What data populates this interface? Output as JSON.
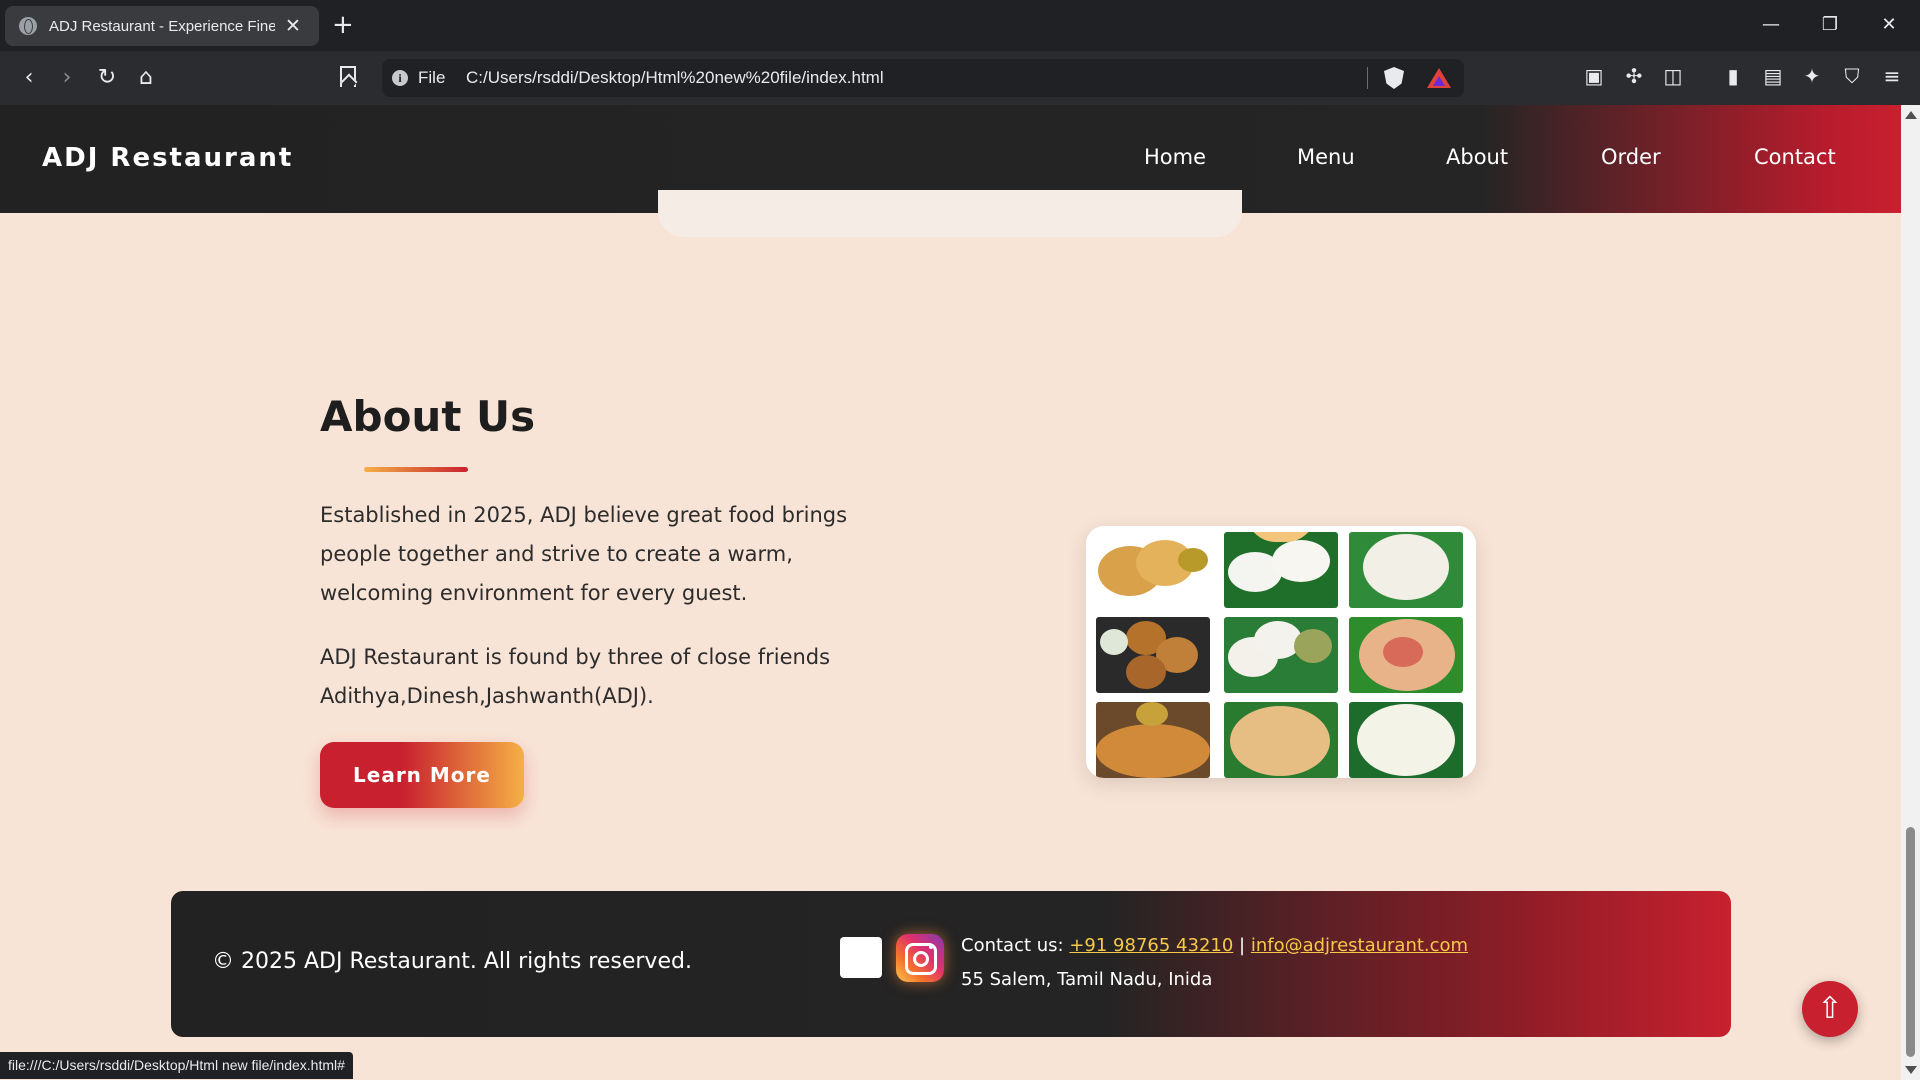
{
  "browser": {
    "tab_title": "ADJ Restaurant - Experience Fine",
    "url_scheme": "File",
    "url": "C:/Users/rsddi/Desktop/Html%20new%20file/index.html",
    "status_url": "file:///C:/Users/rsddi/Desktop/Html new file/index.html#"
  },
  "header": {
    "logo": "ADJ Restaurant",
    "nav": [
      "Home",
      "Menu",
      "About",
      "Order",
      "Contact"
    ]
  },
  "about": {
    "title": "About Us",
    "paragraph1": "Established in 2025, ADJ believe great food brings people together and strive to create a warm, welcoming environment for every guest.",
    "paragraph2": "ADJ Restaurant is found by three of close friends Adithya,Dinesh,Jashwanth(ADJ).",
    "button": "Learn More"
  },
  "footer": {
    "copyright": "© 2025 ADJ Restaurant. All rights reserved.",
    "contact_label": "Contact us:",
    "phone": "+91 98765 43210",
    "separator": "|",
    "email": "info@adjrestaurant.com",
    "address": "55 Salem, Tamil Nadu, Inida"
  },
  "scroll_top_icon": "⇧",
  "colors": {
    "accent_red": "#c8202f",
    "accent_orange": "#f5b045",
    "page_bg": "#f8e4d6",
    "link_yellow": "#f7c948"
  },
  "icons": [
    "globe-icon",
    "close-icon",
    "plus-icon",
    "back-icon",
    "forward-icon",
    "reload-icon",
    "home-icon",
    "bookmark-icon",
    "info-icon",
    "brave-shield-icon",
    "rewards-icon",
    "instagram-icon",
    "arrow-up-icon"
  ]
}
